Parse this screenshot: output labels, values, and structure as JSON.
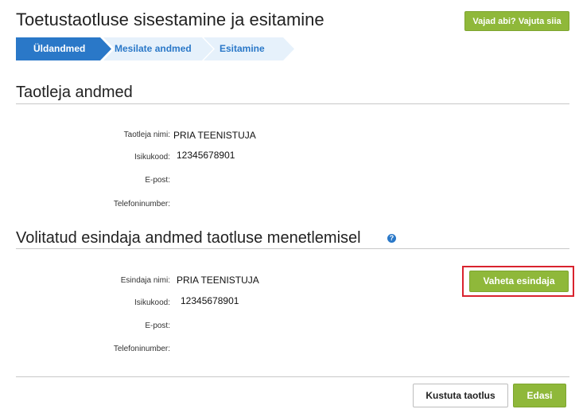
{
  "header": {
    "title": "Toetustaotluse sisestamine ja esitamine",
    "help_button": "Vajad abi? Vajuta siia"
  },
  "steps": [
    {
      "label": "Üldandmed",
      "state": "active"
    },
    {
      "label": "Mesilate andmed",
      "state": "inactive"
    },
    {
      "label": "Esitamine",
      "state": "inactive"
    }
  ],
  "applicant": {
    "title": "Taotleja andmed",
    "fields": [
      {
        "label": "Taotleja nimi:",
        "value": "PRIA TEENISTUJA"
      },
      {
        "label": "Isikukood:",
        "value": "12345678901"
      },
      {
        "label": "E-post:",
        "value": ""
      },
      {
        "label": "Telefoninumber:",
        "value": ""
      }
    ]
  },
  "representative": {
    "title": "Volitatud esindaja andmed taotluse menetlemisel",
    "help_icon": "?",
    "swap_button": "Vaheta esindaja",
    "fields": [
      {
        "label": "Esindaja nimi:",
        "value": "PRIA TEENISTUJA"
      },
      {
        "label": "Isikukood:",
        "value": "12345678901"
      },
      {
        "label": "E-post:",
        "value": ""
      },
      {
        "label": "Telefoninumber:",
        "value": ""
      }
    ]
  },
  "footer": {
    "delete_button": "Kustuta taotlus",
    "next_button": "Edasi"
  },
  "colors": {
    "accent_green": "#8fb83a",
    "step_active": "#2a78c8",
    "step_inactive": "#e6f1fb",
    "step_inactive_text": "#2a78c8",
    "highlight_red": "#d9232e"
  }
}
